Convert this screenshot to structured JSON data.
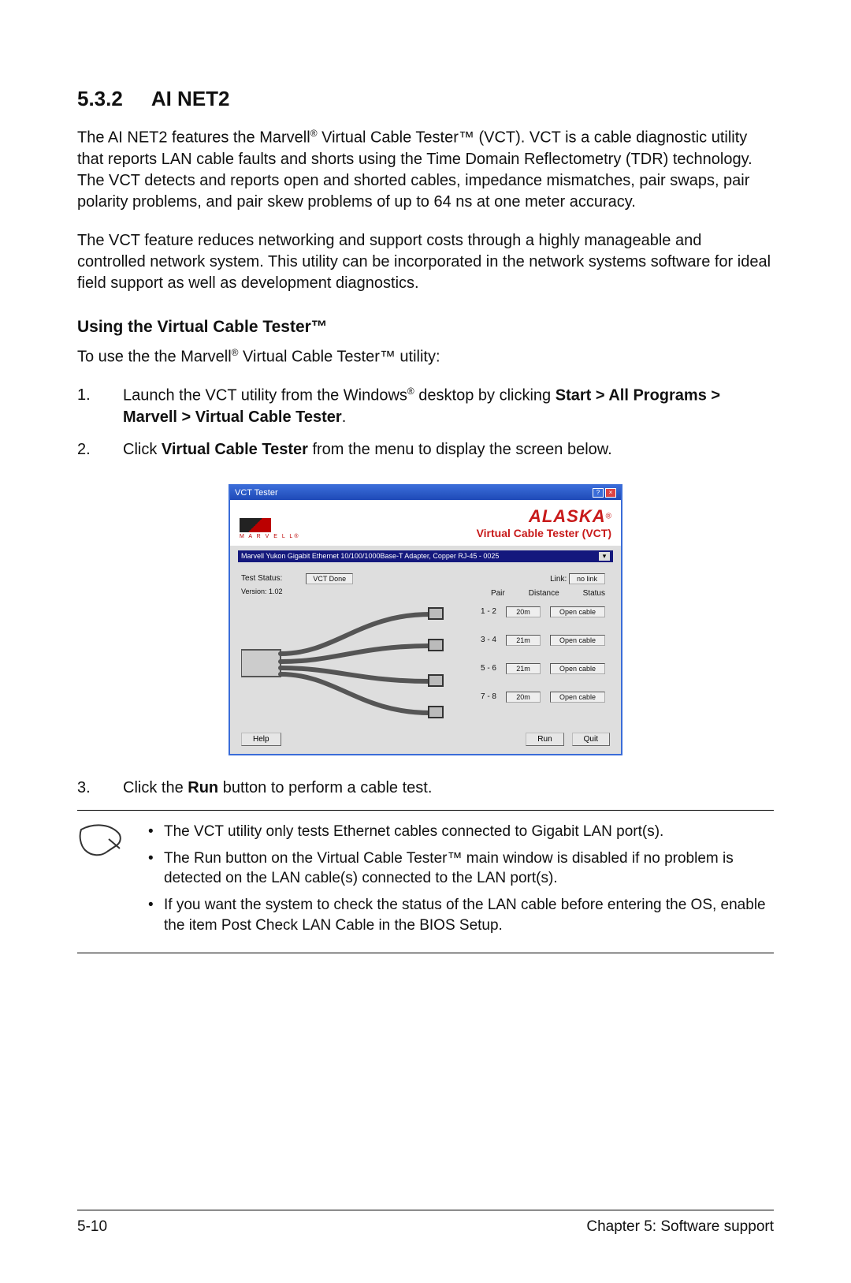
{
  "section": {
    "number": "5.3.2",
    "title": "AI NET2"
  },
  "p1a": "The AI NET2 features the Marvell",
  "p1b": " Virtual Cable Tester™ (VCT). VCT is a cable diagnostic utility that reports LAN cable faults and shorts using the Time Domain Reflectometry (TDR) technology. The VCT detects and reports open and shorted cables, impedance mismatches, pair swaps, pair polarity problems, and pair skew problems of up to 64 ns at one meter accuracy.",
  "p2": "The VCT feature reduces networking and support costs through a highly manageable and controlled network system. This utility can be incorporated in the network systems software for ideal field support as well as development diagnostics.",
  "sub1": "Using the Virtual Cable Tester™",
  "p3a": "To use the the Marvell",
  "p3b": " Virtual Cable Tester™  utility:",
  "step1a": "Launch the VCT utility from the Windows",
  "step1b": " desktop by clicking ",
  "step1_bold": "Start > All Programs > Marvell > Virtual Cable Tester",
  "step1c": ".",
  "step2a": "Click ",
  "step2_bold": "Virtual Cable Tester",
  "step2b": " from the menu to display the screen below.",
  "step3a": "Click the ",
  "step3_bold": "Run",
  "step3b": " button to perform a cable test.",
  "notes": [
    "The VCT utility only tests Ethernet cables connected to Gigabit LAN port(s).",
    "The Run button on the Virtual Cable Tester™ main window is disabled if no problem is detected on the LAN cable(s) connected to the LAN port(s).",
    "If you want the system to check the status of the LAN cable before entering the OS, enable the item Post Check LAN Cable in the BIOS Setup."
  ],
  "vct": {
    "window_title": "VCT Tester",
    "brand_small": "M A R V E L L®",
    "brand_big": "ALASKA",
    "reg": "®",
    "subtitle": "Virtual Cable Tester (VCT)",
    "adapter": "Marvell Yukon Gigabit Ethernet 10/100/1000Base-T Adapter, Copper RJ-45 - 0025",
    "test_status_label": "Test Status:",
    "test_status_value": "VCT  Done",
    "version_label": "Version: 1.02",
    "link_label": "Link:",
    "link_value": "no link",
    "hdr_pair": "Pair",
    "hdr_distance": "Distance",
    "hdr_status": "Status",
    "pairs": [
      {
        "pair": "1 - 2",
        "distance": "20m",
        "status": "Open cable"
      },
      {
        "pair": "3 - 4",
        "distance": "21m",
        "status": "Open cable"
      },
      {
        "pair": "5 - 6",
        "distance": "21m",
        "status": "Open cable"
      },
      {
        "pair": "7 - 8",
        "distance": "20m",
        "status": "Open cable"
      }
    ],
    "btn_help": "Help",
    "btn_run": "Run",
    "btn_quit": "Quit"
  },
  "footer": {
    "left": "5-10",
    "right": "Chapter 5: Software support"
  },
  "sup_reg": "®"
}
